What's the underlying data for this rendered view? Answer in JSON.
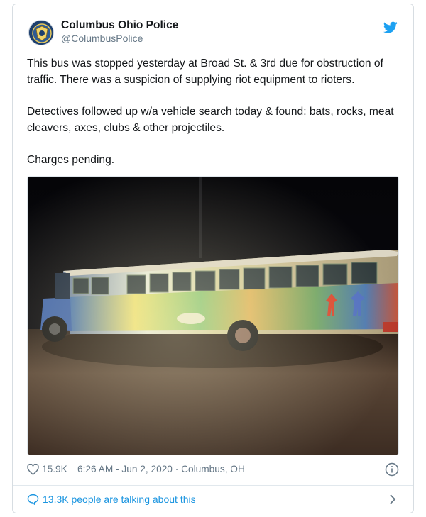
{
  "account": {
    "display_name": "Columbus Ohio Police",
    "handle": "@ColumbusPolice"
  },
  "tweet": {
    "paragraphs": [
      "This bus was stopped yesterday at Broad St. & 3rd due for obstruction of traffic. There was a suspicion of supplying riot equipment to rioters.",
      "Detectives followed up w/a vehicle search today & found: bats, rocks, meat cleavers, axes, clubs & other projectiles.",
      "Charges pending."
    ]
  },
  "meta": {
    "likes": "15.9K",
    "timestamp": "6:26 AM - Jun 2, 2020 · Columbus, OH"
  },
  "footer": {
    "talking": "13.3K people are talking about this"
  },
  "icons": {
    "brand": "twitter-bird-icon",
    "like": "heart-icon",
    "info": "info-icon",
    "reply": "speech-bubble-icon",
    "next": "chevron-right-icon"
  },
  "colors": {
    "twitter_blue": "#1da1f2",
    "link_blue": "#1b95e0",
    "text_primary": "#14171a",
    "text_secondary": "#657786"
  }
}
